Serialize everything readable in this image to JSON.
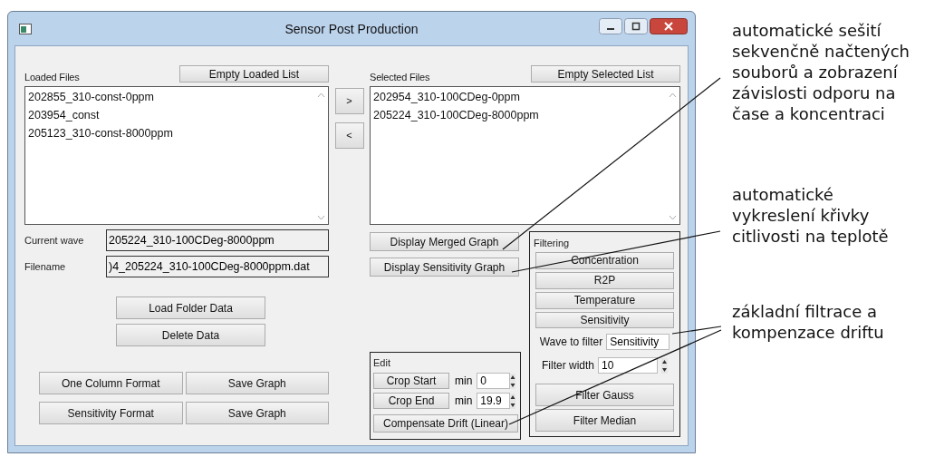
{
  "window": {
    "title": "Sensor Post Production"
  },
  "loaded_files": {
    "label": "Loaded Files",
    "empty_button": "Empty Loaded List",
    "items": [
      "202855_310-const-0ppm",
      "203954_const",
      "205123_310-const-8000ppm"
    ]
  },
  "transfer_buttons": [
    ">",
    "<"
  ],
  "selected_files": {
    "label": "Selected Files",
    "empty_button": "Empty Selected List",
    "items": [
      "202954_310-100CDeg-0ppm",
      "205224_310-100CDeg-8000ppm"
    ]
  },
  "current_wave": {
    "label": "Current wave",
    "value": "205224_310-100CDeg-8000ppm"
  },
  "filename": {
    "label": "Filename",
    "value": ")4_205224_310-100CDeg-8000ppm.dat"
  },
  "data_buttons": [
    "Load Folder Data",
    "Delete Data"
  ],
  "export_rows": [
    {
      "format": "One Column Format",
      "save": "Save Graph"
    },
    {
      "format": "Sensitivity Format",
      "save": "Save Graph"
    }
  ],
  "display_buttons": [
    "Display Merged Graph",
    "Display Sensitivity Graph"
  ],
  "edit": {
    "title": "Edit",
    "crops": [
      {
        "button": "Crop Start",
        "unit": "min",
        "value": "0"
      },
      {
        "button": "Crop End",
        "unit": "min",
        "value": "19.9"
      }
    ],
    "drift_button": "Compensate Drift (Linear)"
  },
  "filtering": {
    "title": "Filtering",
    "wave_buttons": [
      "Concentration",
      "R2P",
      "Temperature",
      "Sensitivity"
    ],
    "wave_to_filter": {
      "label": "Wave to filter",
      "value": "Sensitivity"
    },
    "filter_width": {
      "label": "Filter width",
      "value": "10"
    },
    "filter_buttons": [
      "Filter Gauss",
      "Filter Median"
    ]
  },
  "annotations": [
    {
      "lines": [
        "automatické sešití",
        "sekvenčně načtených",
        "souborů a zobrazení",
        "závislosti odporu na",
        "čase a koncentraci"
      ]
    },
    {
      "lines": [
        "automatické",
        "vykreslení křivky",
        "citlivosti na teplotě"
      ]
    },
    {
      "lines": [
        "základní filtrace a",
        "kompenzace driftu"
      ]
    }
  ]
}
